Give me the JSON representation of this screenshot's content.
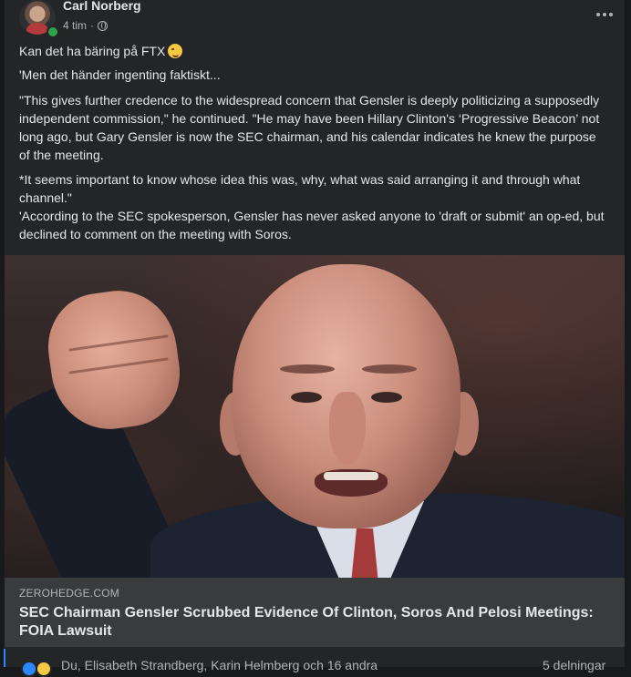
{
  "post": {
    "author": "Carl Norberg",
    "time": "4 tim",
    "separator": "·",
    "audience_icon": "globe-icon",
    "more_icon": "more-horizontal-icon",
    "paragraphs": [
      "Kan det ha bäring på FTX",
      "'Men det händer ingenting faktiskt...",
      "\"This gives further credence to the widespread concern that Gensler is deeply politicizing a supposedly independent commission,\" he continued. \"He may have been Hillary Clinton's ‘Progressive Beacon’ not long ago, but Gary Gensler is now the SEC chairman, and his calendar indicates he knew the purpose of the meeting.",
      "*It seems important to know whose idea this was, why, what was said arranging it and through what channel.\"\n'According to the SEC spokesperson, Gensler has never asked anyone to 'draft or submit' an op-ed, but declined to comment on the meeting with Soros."
    ],
    "emoji": "winking-face-emoji"
  },
  "link": {
    "domain": "ZEROHEDGE.COM",
    "title": "SEC Chairman Gensler Scrubbed Evidence Of Clinton, Soros And Pelosi Meetings: FOIA Lawsuit"
  },
  "footer": {
    "reaction_icons": [
      "like-reaction-icon",
      "care-reaction-icon"
    ],
    "reactions_text": "Du, Elisabeth Strandberg, Karin Helmberg och 16 andra",
    "shares_text": "5 delningar"
  },
  "colors": {
    "page_background": "#18191a",
    "card_background": "#242526",
    "link_background": "#3a3b3c",
    "primary_text": "#e4e6eb",
    "secondary_text": "#b0b3b8",
    "online": "#31a24c",
    "accent": "#2d88ff"
  }
}
